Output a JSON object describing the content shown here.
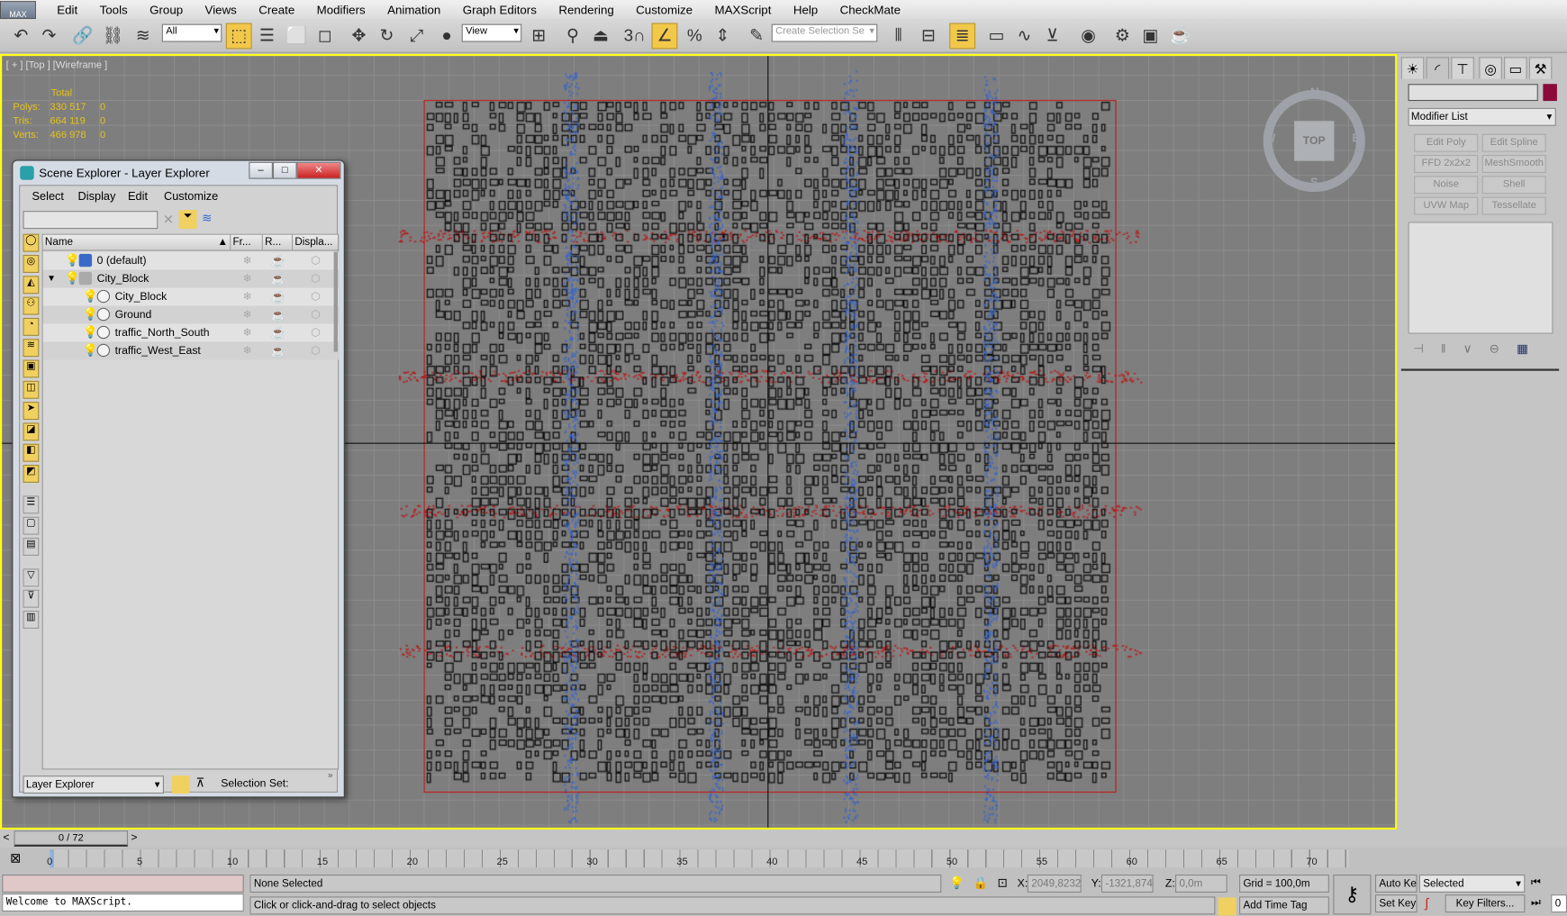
{
  "app": {
    "logo": "MAX"
  },
  "menu": [
    "Edit",
    "Tools",
    "Group",
    "Views",
    "Create",
    "Modifiers",
    "Animation",
    "Graph Editors",
    "Rendering",
    "Customize",
    "MAXScript",
    "Help",
    "CheckMate"
  ],
  "toolbar": {
    "filter": "All",
    "ref_coord": "View",
    "snap_count": "3",
    "selection_set_placeholder": "Create Selection Se"
  },
  "viewport": {
    "label": "[ + ] [Top ] [Wireframe ]",
    "stats": {
      "header": "Total",
      "rows": [
        {
          "label": "Polys:",
          "total": "330 517",
          "sel": "0"
        },
        {
          "label": "Tris:",
          "total": "664 119",
          "sel": "0"
        },
        {
          "label": "Verts:",
          "total": "466 978",
          "sel": "0"
        }
      ]
    },
    "viewcube": {
      "face": "TOP",
      "n": "N",
      "s": "S",
      "e": "E",
      "w": "W"
    },
    "colors": {
      "border": "#ffff1a",
      "blocks": "#111111",
      "bounds": "#c01818",
      "traffic_ns": "#3a66c8",
      "traffic_we": "#b81a1a"
    }
  },
  "explorer": {
    "title": "Scene Explorer - Layer Explorer",
    "menu": [
      "Select",
      "Display",
      "Edit",
      "Customize"
    ],
    "columns": [
      "Name",
      "Fr...",
      "R...",
      "Displa..."
    ],
    "rows": [
      {
        "name": "0 (default)",
        "level": 0,
        "type": "layer-active"
      },
      {
        "name": "City_Block",
        "level": 0,
        "type": "layer",
        "expanded": true
      },
      {
        "name": "City_Block",
        "level": 1,
        "type": "object"
      },
      {
        "name": "Ground",
        "level": 1,
        "type": "object"
      },
      {
        "name": "traffic_North_South",
        "level": 1,
        "type": "object"
      },
      {
        "name": "traffic_West_East",
        "level": 1,
        "type": "object"
      }
    ],
    "mode": "Layer Explorer",
    "selection_set_label": "Selection Set:"
  },
  "panel": {
    "modifier_list": "Modifier List",
    "object_color": "#8b0a3a",
    "buttons": [
      "Edit Poly",
      "Edit Spline",
      "FFD 2x2x2",
      "MeshSmooth",
      "Noise",
      "Shell",
      "UVW Map",
      "Tessellate"
    ]
  },
  "timeline": {
    "frame": "0 / 72",
    "ticks": [
      "0",
      "5",
      "10",
      "15",
      "20",
      "25",
      "30",
      "35",
      "40",
      "45",
      "50",
      "55",
      "60",
      "65",
      "70"
    ]
  },
  "status": {
    "selection": "None Selected",
    "prompt": "Click or click-and-drag to select objects",
    "maxscript": "Welcome to MAXScript.",
    "x_label": "X:",
    "x": "2049,8232",
    "y_label": "Y:",
    "y": "-1321,874",
    "z_label": "Z:",
    "z": "0,0m",
    "grid": "Grid = 100,0m",
    "add_time_tag": "Add Time Tag",
    "auto_key": "Auto Key",
    "set_key": "Set Key",
    "key_mode": "Selected",
    "key_filters": "Key Filters...",
    "frame_field": "0"
  }
}
